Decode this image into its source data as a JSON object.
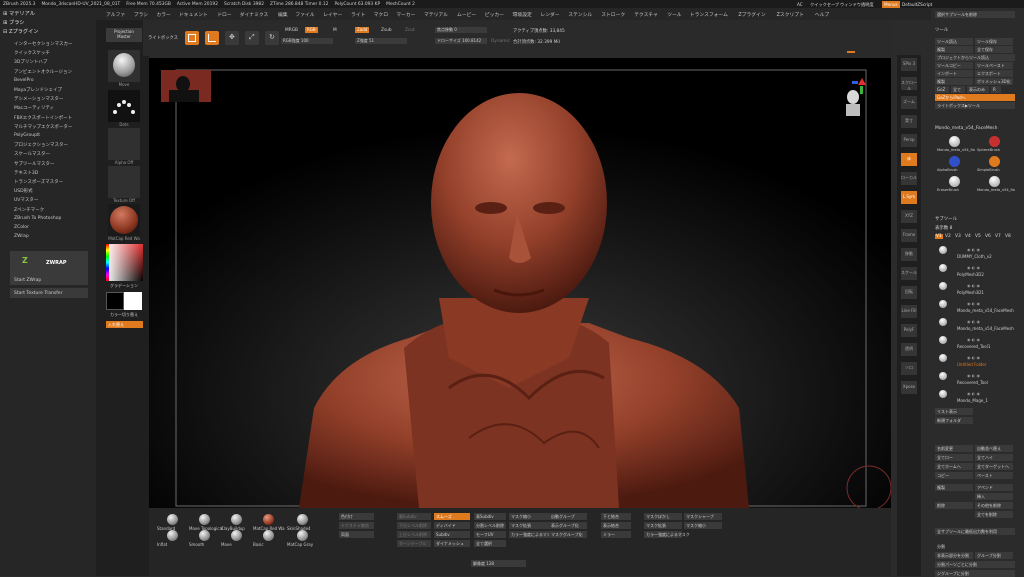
{
  "titlebar": {
    "app": "ZBrush 2025.3",
    "doc": "Mondo_3dscanHD-UV_2021_08_01T",
    "free_mem": "Free Mem 70.453GB",
    "active_mem": "Active Mem 20192",
    "scratch": "Scratch Disk 3982",
    "ztime": "ZTime 286.848 Timer 0.12",
    "polycount": "PolyCount 63.093 KP",
    "meshcount": "MeshCount 2",
    "ac": "AC",
    "quicksave": "クイックセーブ",
    "transparency": "ウィンドウ透明度",
    "menus": "Menus",
    "defaultscript": "DefaultZScript",
    "hide_bar": "選択サブツールを削除"
  },
  "menubar": [
    "アルファ",
    "ブラシ",
    "カラー",
    "ドキュメント",
    "ドロー",
    "ダイナミクス",
    "編集",
    "ファイル",
    "レイヤー",
    "ライト",
    "マクロ",
    "マーカー",
    "マテリアル",
    "ムービー",
    "ピッカー",
    "環境設定",
    "レンダー",
    "ステンシル",
    "ストローク",
    "テクスチャ",
    "ツール",
    "トランスフォーム",
    "Zプラグイン",
    "Zスクリプト",
    "ヘルプ"
  ],
  "leftpanel": {
    "headers": [
      "マテリアル",
      "ブラシ",
      "Zプラグイン"
    ],
    "items": [
      "インターセクションマスカー",
      "クイックスケッチ",
      "3Dプリントハブ",
      "アンビエントオクルージョン",
      "BevelPro",
      "Mayaブレンドシェイプ",
      "デシメーションマスター",
      "Macユーティリティ",
      "FBXエクスポートインポート",
      "マルチマップエクスポーター",
      "PolyGroupIt",
      "プロジェクションマスター",
      "スケールマスター",
      "サブツールマスター",
      "テキスト3D",
      "トランスポーズマスター",
      "USD形式",
      "UVマスター",
      "Zベンチマーク",
      "ZBrush To Photoshop",
      "ZColor",
      "ZWrap"
    ],
    "zwrap_logo": "ZWRAP",
    "start_zwrap": "Start ZWrap",
    "start_transfer": "Start Texture Transfer"
  },
  "shelf": {
    "projection": "Projection",
    "master": "Master",
    "move": "Move",
    "dots": "Dots",
    "alpha_off": "Alpha Off",
    "texture_off": "Texture Off",
    "matcap": "MatCap Red Wa",
    "gradient": "グラデーション",
    "switch_color": "カラー切り替え",
    "swap": "入れ替え"
  },
  "toolbar": {
    "lightbox": "ライトボックス",
    "edit": "Edit",
    "draw": "ドロー",
    "move": "移動",
    "scale": "スケール",
    "rotate": "回転",
    "mrgb": "MRGB",
    "rgb": "RGB",
    "m": "M",
    "rgb_intensity": "RGB強度 100",
    "zadd": "Zadd",
    "zsub": "Zsub",
    "zcut": "Zcut",
    "z_intensity": "Z強度 51",
    "focal_shift": "焦点移動 0",
    "draw_size": "ドローサイズ 100.8142",
    "dynamic": "Dynamic",
    "active_points": "アクティブ頂点数: 33,845",
    "total_points": "合計頂点数: 32.399 Mil"
  },
  "bottombar": {
    "brushes": [
      "Standard",
      "Move Topological",
      "ClayBuildup",
      "MatCap Red Wa",
      "SkinShade4",
      "Inflat",
      "Smooth",
      "Move",
      "Basic",
      "MatCap Gray"
    ],
    "col1": [
      "色付け",
      "テクスチャ無効",
      "両面"
    ],
    "col2": [
      "スムーズ",
      "ディバイド",
      "Subdiv",
      "ダイナメッシュ"
    ],
    "col2b": [
      "最Subdiv",
      "下位レベル削除",
      "上位レベル削除",
      "ターンテーブル"
    ],
    "col3": [
      "表Subdiv",
      "分割レベル削除",
      "モーフUV",
      "全て選択"
    ],
    "col4": [
      "マスク縮小",
      "マスク拡張",
      "カラー強度によるマスク"
    ],
    "col5": [
      "自動グループ",
      "表示グループ化",
      "マスクグループ化"
    ],
    "col6": [
      "下と結合",
      "表示結合",
      "ミラー"
    ],
    "col7": [
      "マスクぼかし",
      "マスク拡張",
      "カラー強度によるマスク"
    ],
    "col8": [
      "マスクシャープ",
      "マスク縮小"
    ],
    "resolution": "解像度 128"
  },
  "righttray": [
    "SPix 3",
    "スクロール",
    "ズーム",
    "実寸",
    "Persp",
    "床",
    "ローカル",
    "L.Sym",
    "XYZ",
    "Frame",
    "移動",
    "スケール",
    "回転",
    "Line Fill",
    "PolyF",
    "透明",
    "ソロ",
    "Xpose"
  ],
  "rightpanel": {
    "tool_header": "ツール",
    "tool_buttons": [
      "ツール読込",
      "ツール保存",
      "複製",
      "全て保存",
      "プロジェクトからツール読込",
      "ツールコピー",
      "ツールペースト",
      "インポート",
      "エクスポート",
      "複製",
      "ポリメッシュ3D化",
      "GoZ",
      "全て",
      "表示のみ",
      "R",
      "GoZからiPadへ",
      "ライトボックス▶ツール"
    ],
    "current_tool": "Mondo_meta_v54_FaceMesh",
    "tool_thumbs": [
      "Mondo_meta_v54_FaceMesh",
      "SphereBrush",
      "AlphaBrush",
      "SimpleBrush",
      "EraserBrush",
      "Mondo_meta_v54_FaceMesh"
    ],
    "subtool_header": "サブツール",
    "visible_count": "表示数 8",
    "versions": [
      "V1",
      "V2",
      "V3",
      "V4",
      "V5",
      "V6",
      "V7",
      "V8"
    ],
    "subtools": [
      "DUMMY_Cloth_v2",
      "PolyMesh3D2",
      "PolyMesh3D1",
      "Mondo_meta_v54_FaceMesh",
      "Mondo_meta_v54_FaceMesh",
      "Recovered_Tool1",
      "Untitled Folder",
      "Recovered_Tool",
      "Mondo_Mage_1"
    ],
    "list_buttons": [
      "リスト表示",
      "新規フォルダ"
    ],
    "ops": [
      "名前変更",
      "自動並べ替え",
      "全てロー",
      "全てハイ",
      "全てホームへ",
      "全てターゲットへ",
      "コピー",
      "ペースト",
      "複製",
      "アペンド",
      "挿入",
      "削除",
      "その他を削除",
      "全てを削除"
    ],
    "bottom": [
      "全サブツールに最低出力数を利用",
      "分割",
      "非表示部分を分割",
      "グループ分割",
      "分割パーツごとに分割",
      "ジグループに分割"
    ]
  }
}
